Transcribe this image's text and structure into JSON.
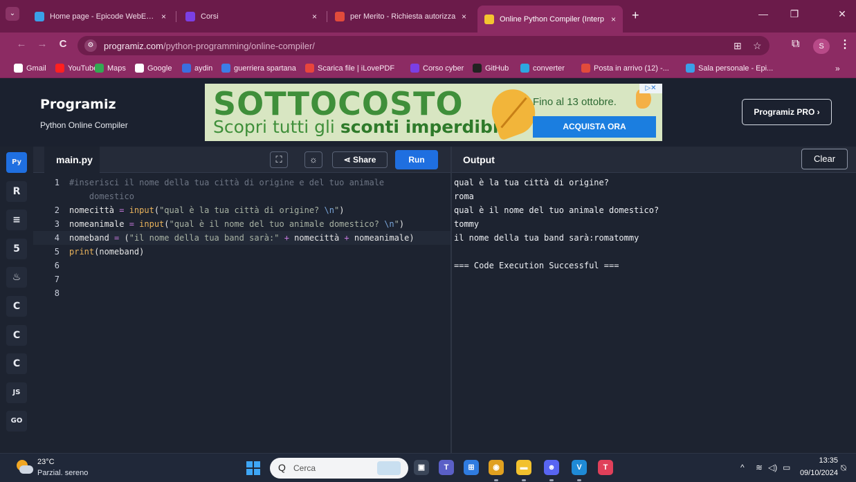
{
  "browser": {
    "tabs": [
      {
        "title": "Home page - Epicode WebEx E",
        "color": "#3aa0e8"
      },
      {
        "title": "Corsi",
        "color": "#7b3fe4"
      },
      {
        "title": "per Merito - Richiesta autorizza",
        "color": "#e24b3b"
      },
      {
        "title": "Online Python Compiler (Interp",
        "color": "#f4c430"
      }
    ],
    "tab_close": "×",
    "new_tab": "+",
    "window": {
      "minimize": "—",
      "restore": "❐",
      "close": "✕"
    },
    "nav": {
      "back": "←",
      "forward": "→",
      "reload": "C"
    },
    "url_host": "programiz.com",
    "url_path": "/python-programming/online-compiler/",
    "profile_initial": "S"
  },
  "bookmarks": [
    {
      "label": "Gmail",
      "color": "#ffffff"
    },
    {
      "label": "YouTube",
      "color": "#ff2020"
    },
    {
      "label": "Maps",
      "color": "#34a853"
    },
    {
      "label": "Google",
      "color": "#ffffff"
    },
    {
      "label": "aydin",
      "color": "#3b6fe0"
    },
    {
      "label": "guerriera spartana",
      "color": "#3c7de6"
    },
    {
      "label": "Scarica file | iLovePDF",
      "color": "#e8453c"
    },
    {
      "label": "Corso cyber",
      "color": "#7b3fe4"
    },
    {
      "label": "GitHub",
      "color": "#222222"
    },
    {
      "label": "converter",
      "color": "#2da6e0"
    },
    {
      "label": "Posta in arrivo (12) -...",
      "color": "#e24b3b"
    },
    {
      "label": "Sala personale - Epi...",
      "color": "#3aa0e8"
    }
  ],
  "bookmarks_more": "»",
  "site": {
    "logo": "Programiz",
    "subtitle": "Python Online Compiler",
    "pro_button": "Programiz PRO ›",
    "ad": {
      "headline": "SOTTOCOSTO",
      "sub_prefix": "Scopri tutti gli ",
      "sub_bold": "sconti imperdibili.",
      "date": "Fino al 13 ottobre.",
      "cta": "ACQUISTA ORA",
      "badge": "▷✕"
    }
  },
  "rail": [
    "Py",
    "R",
    "≡",
    "5",
    "♨",
    "C",
    "C",
    "C",
    "JS",
    "GO"
  ],
  "editor": {
    "file_name": "main.py",
    "fullscreen_icon": "⛶",
    "theme_icon": "☼",
    "share_label": "Share",
    "run_label": "Run",
    "lines": [
      {
        "n": "1",
        "parts": [
          {
            "t": "#inserisci il nome della tua città di origine e del tuo animale",
            "c": "cm"
          }
        ]
      },
      {
        "n": "",
        "parts": [
          {
            "t": "    domestico",
            "c": "cm"
          }
        ]
      },
      {
        "n": "2",
        "parts": [
          {
            "t": "nomecittà ",
            "c": ""
          },
          {
            "t": "=",
            "c": "op"
          },
          {
            "t": " input",
            "c": "kw"
          },
          {
            "t": "(",
            "c": ""
          },
          {
            "t": "\"qual è la tua città di origine? ",
            "c": "st"
          },
          {
            "t": "\\n",
            "c": "esc"
          },
          {
            "t": "\"",
            "c": "st"
          },
          {
            "t": ")",
            "c": ""
          }
        ]
      },
      {
        "n": "3",
        "parts": [
          {
            "t": "nomeanimale ",
            "c": ""
          },
          {
            "t": "=",
            "c": "op"
          },
          {
            "t": " input",
            "c": "kw"
          },
          {
            "t": "(",
            "c": ""
          },
          {
            "t": "\"qual è il nome del tuo animale domestico? ",
            "c": "st"
          },
          {
            "t": "\\n",
            "c": "esc"
          },
          {
            "t": "\"",
            "c": "st"
          },
          {
            "t": ")",
            "c": ""
          }
        ]
      },
      {
        "n": "4",
        "cur": true,
        "parts": [
          {
            "t": "nomeband ",
            "c": ""
          },
          {
            "t": "=",
            "c": "op"
          },
          {
            "t": " (",
            "c": ""
          },
          {
            "t": "\"il nome della tua band sarà:\"",
            "c": "st"
          },
          {
            "t": " + ",
            "c": "op"
          },
          {
            "t": "nomecittà",
            "c": ""
          },
          {
            "t": " + ",
            "c": "op"
          },
          {
            "t": "nomeanimale)",
            "c": ""
          }
        ]
      },
      {
        "n": "5",
        "parts": [
          {
            "t": "print",
            "c": "kw"
          },
          {
            "t": "(nomeband)",
            "c": ""
          }
        ]
      },
      {
        "n": "6",
        "parts": []
      },
      {
        "n": "7",
        "parts": []
      },
      {
        "n": "8",
        "parts": []
      }
    ]
  },
  "output": {
    "title": "Output",
    "clear_label": "Clear",
    "lines": [
      "qual è la tua città di origine?",
      "roma",
      "qual è il nome del tuo animale domestico?",
      "tommy",
      "il nome della tua band sarà:romatommy",
      "",
      "=== Code Execution Successful ==="
    ]
  },
  "taskbar": {
    "temperature": "23°C",
    "condition": "Parzial. sereno",
    "search_placeholder": "Cerca",
    "search_icon": "Q",
    "apps": [
      {
        "name": "task-view",
        "glyph": "▣",
        "color": "#3a4558"
      },
      {
        "name": "teams",
        "glyph": "T",
        "color": "#5a5fc7"
      },
      {
        "name": "store",
        "glyph": "⊞",
        "color": "#2f7be0"
      },
      {
        "name": "chrome",
        "glyph": "◉",
        "color": "#e0a020"
      },
      {
        "name": "file-explorer",
        "glyph": "▬",
        "color": "#f2c12e"
      },
      {
        "name": "discord",
        "glyph": "☻",
        "color": "#5865f2"
      },
      {
        "name": "vscode",
        "glyph": "V",
        "color": "#1f8ad6"
      },
      {
        "name": "app",
        "glyph": "T",
        "color": "#e0405a"
      }
    ],
    "tray": {
      "chevron": "^",
      "wifi": "≋",
      "volume": "◁)",
      "battery": "▭"
    },
    "time": "13:35",
    "date": "09/10/2024",
    "notification": "⍉"
  }
}
